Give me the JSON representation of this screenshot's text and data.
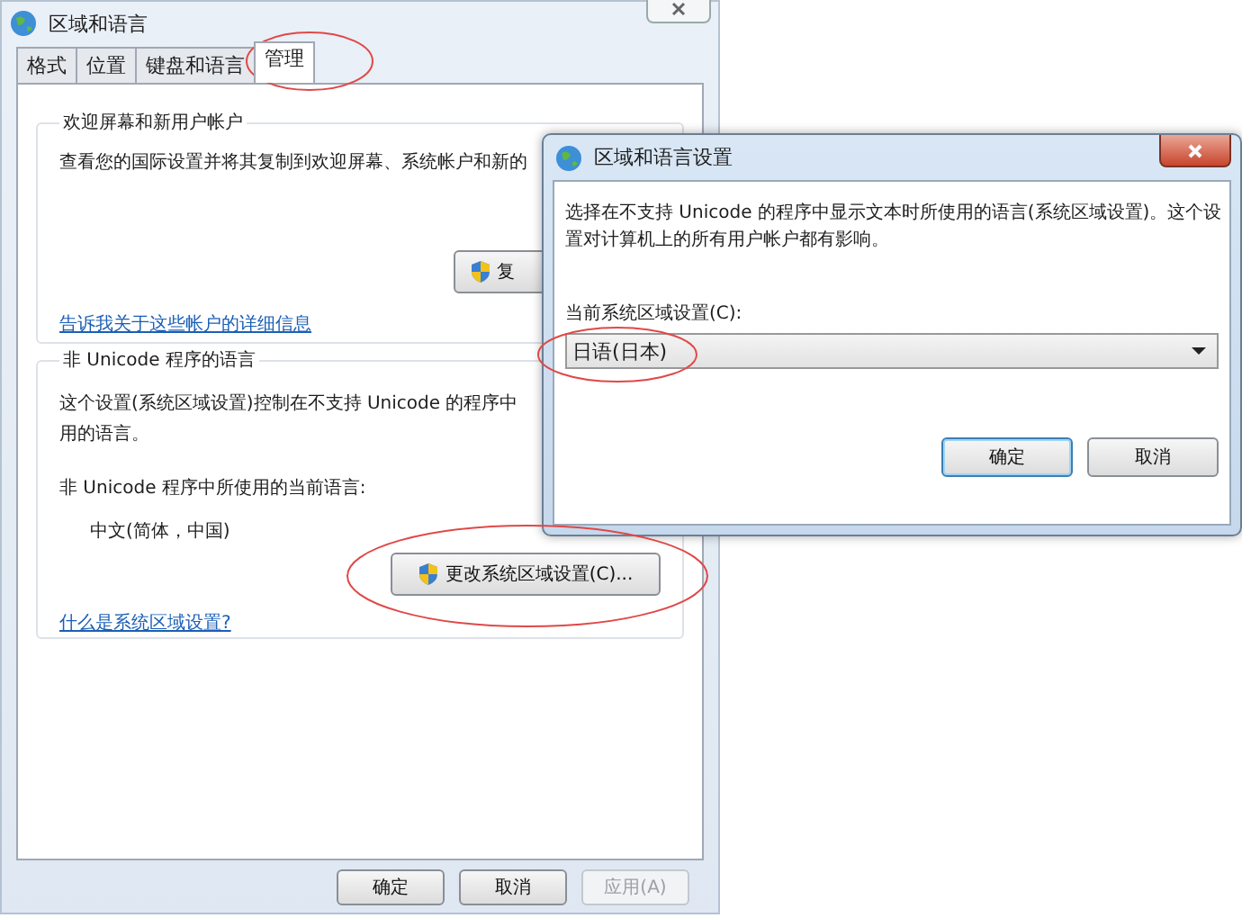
{
  "window": {
    "title": "区域和语言"
  },
  "tabs": [
    {
      "label": "格式",
      "selected": false
    },
    {
      "label": "位置",
      "selected": false
    },
    {
      "label": "键盘和语言",
      "selected": false
    },
    {
      "label": "管理",
      "selected": true
    }
  ],
  "welcome_group": {
    "title": "欢迎屏幕和新用户帐户",
    "description": "查看您的国际设置并将其复制到欢迎屏幕、系统帐户和新的",
    "button": "复",
    "link": "告诉我关于这些帐户的详细信息"
  },
  "unicode_group": {
    "title": "非 Unicode 程序的语言",
    "description_lines": [
      "这个设置(系统区域设置)控制在不支持 Unicode 的程序中",
      "用的语言。"
    ],
    "current_label": "非 Unicode 程序中所使用的当前语言:",
    "current_value": "中文(简体，中国)",
    "button": "更改系统区域设置(C)...",
    "link": "什么是系统区域设置?"
  },
  "buttons": [
    {
      "label": "确定",
      "disabled": false
    },
    {
      "label": "取消",
      "disabled": false
    },
    {
      "label": "应用(A)",
      "disabled": true
    }
  ],
  "dialog": {
    "title": "区域和语言设置",
    "description": "选择在不支持 Unicode 的程序中显示文本时所使用的语言(系统区域设置)。这个设置对计算机上的所有用户帐户都有影响。",
    "locale_label": "当前系统区域设置(C):",
    "locale_value": "日语(日本)",
    "buttons": [
      "确定",
      "取消"
    ]
  }
}
